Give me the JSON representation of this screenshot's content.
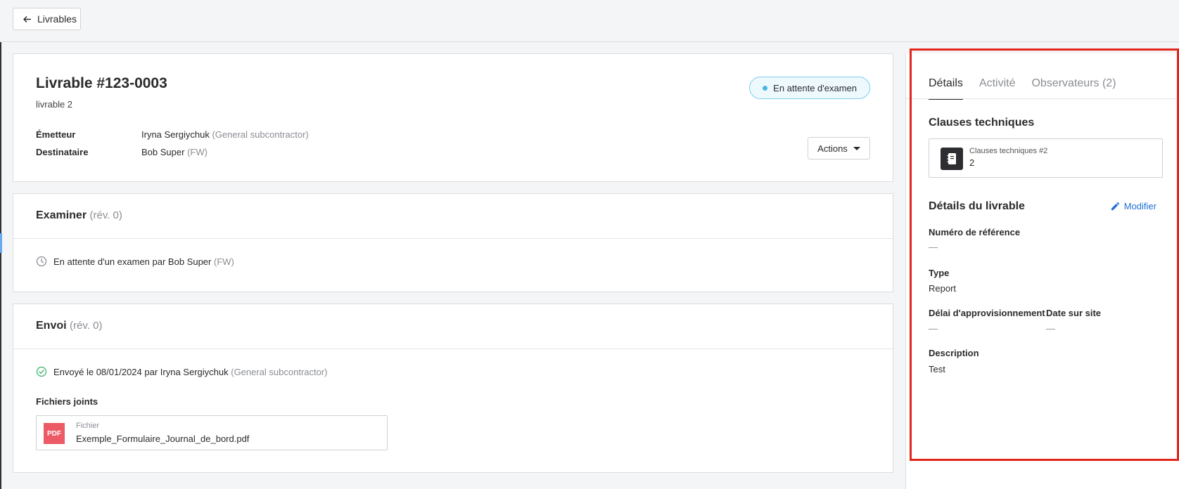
{
  "topbar": {
    "back_label": "Livrables"
  },
  "header": {
    "title": "Livrable #123-0003",
    "subtitle": "livrable 2",
    "status": "En attente d'examen",
    "sender_label": "Émetteur",
    "sender_name": "Iryna Sergiychuk",
    "sender_org": "(General subcontractor)",
    "recipient_label": "Destinataire",
    "recipient_name": "Bob Super",
    "recipient_org": "(FW)",
    "actions_label": "Actions"
  },
  "review": {
    "title": "Examiner",
    "rev": "(rév. 0)",
    "pending_text": "En attente d'un examen par Bob Super",
    "pending_org": "(FW)"
  },
  "send": {
    "title": "Envoi",
    "rev": "(rév. 0)",
    "sent_text": "Envoyé le 08/01/2024 par Iryna Sergiychuk",
    "sent_org": "(General subcontractor)",
    "files_label": "Fichiers joints",
    "file": {
      "badge": "PDF",
      "kind": "Fichier",
      "name": "Exemple_Formulaire_Journal_de_bord.pdf"
    }
  },
  "panel": {
    "tabs": [
      {
        "label": "Détails",
        "active": true
      },
      {
        "label": "Activité",
        "active": false
      },
      {
        "label": "Observateurs (2)",
        "active": false
      }
    ],
    "clauses_heading": "Clauses techniques",
    "clause": {
      "title": "Clauses techniques #2",
      "number": "2"
    },
    "details_heading": "Détails du livrable",
    "edit_label": "Modifier",
    "fields": {
      "reference": {
        "label": "Numéro de référence",
        "value": "—"
      },
      "type": {
        "label": "Type",
        "value": "Report"
      },
      "lead_time": {
        "label": "Délai d'approvisionnement",
        "value": "—"
      },
      "site_date": {
        "label": "Date sur site",
        "value": "—"
      },
      "description": {
        "label": "Description",
        "value": "Test"
      }
    }
  },
  "colors": {
    "accent_blue": "#1f6fd6",
    "status_dot": "#49b6e8",
    "pdf_red": "#ec5b65",
    "highlight_red": "#e2261c",
    "success_green": "#3bb56b"
  },
  "icons": {
    "back": "arrow-left-icon",
    "clock": "clock-icon",
    "check": "check-circle-icon",
    "clause": "notebook-icon",
    "edit": "pencil-icon",
    "caret": "caret-down-icon"
  }
}
